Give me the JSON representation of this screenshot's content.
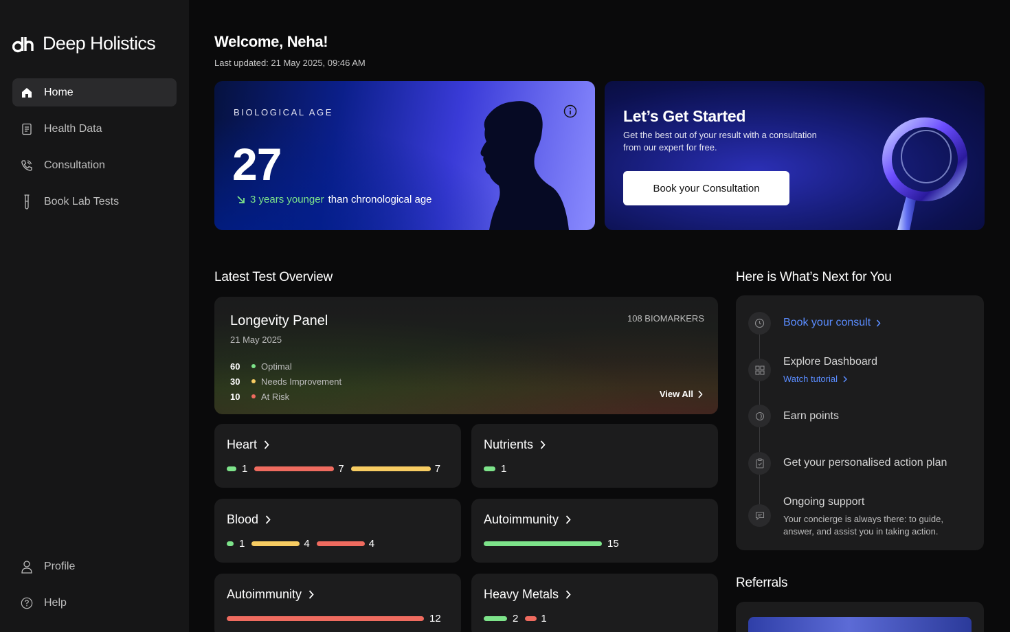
{
  "brand": {
    "name": "Deep Holistics"
  },
  "sidebar": {
    "items": [
      {
        "label": "Home",
        "icon": "home-icon",
        "active": true
      },
      {
        "label": "Health Data",
        "icon": "document-icon",
        "active": false
      },
      {
        "label": "Consultation",
        "icon": "phone-icon",
        "active": false
      },
      {
        "label": "Book Lab Tests",
        "icon": "test-tube-icon",
        "active": false
      }
    ],
    "bottom": [
      {
        "label": "Profile",
        "icon": "user-icon"
      },
      {
        "label": "Help",
        "icon": "help-icon"
      }
    ]
  },
  "header": {
    "welcome": "Welcome, Neha!",
    "updated": "Last updated: 21 May 2025, 09:46 AM"
  },
  "bio_age": {
    "label": "BIOLOGICAL AGE",
    "value": "27",
    "delta": "3 years younger",
    "delta_suffix": "than chronological age"
  },
  "consult": {
    "title": "Let’s Get Started",
    "description": "Get the best out of your result with a consultation from our expert for free.",
    "button": "Book your Consultation"
  },
  "overview": {
    "title": "Latest Test Overview",
    "panel": {
      "title": "Longevity Panel",
      "date": "21 May 2025",
      "count": "108 BIOMARKERS",
      "stats": [
        {
          "num": "60",
          "label": "Optimal",
          "color": "#7de38a"
        },
        {
          "num": "30",
          "label": "Needs Improvement",
          "color": "#f7cc62"
        },
        {
          "num": "10",
          "label": "At Risk",
          "color": "#ef6b5f"
        }
      ],
      "view_all": "View All"
    },
    "categories": [
      {
        "title": "Heart",
        "bars": [
          {
            "kind": "green",
            "value": "1"
          },
          {
            "kind": "red",
            "value": "7"
          },
          {
            "kind": "yellow",
            "value": "7"
          }
        ]
      },
      {
        "title": "Nutrients",
        "bars": [
          {
            "kind": "green",
            "value": "1"
          }
        ]
      },
      {
        "title": "Blood",
        "bars": [
          {
            "kind": "green",
            "value": "1"
          },
          {
            "kind": "yellow",
            "value": "4"
          },
          {
            "kind": "red",
            "value": "4"
          }
        ]
      },
      {
        "title": "Autoimmunity",
        "bars": [
          {
            "kind": "green",
            "value": "15"
          }
        ]
      },
      {
        "title": "Autoimmunity",
        "bars": [
          {
            "kind": "red",
            "value": "12"
          }
        ]
      },
      {
        "title": "Heavy Metals",
        "bars": [
          {
            "kind": "green",
            "value": "2"
          },
          {
            "kind": "red",
            "value": "1"
          }
        ]
      }
    ]
  },
  "next": {
    "title": "Here is What’s Next for You",
    "steps": {
      "book": "Book your consult",
      "explore": "Explore Dashboard",
      "watch": "Watch tutorial",
      "earn": "Earn points",
      "plan": "Get your personalised action plan",
      "support": "Ongoing support",
      "support_desc": "Your concierge is always there: to guide, answer, and assist you in taking action."
    }
  },
  "referrals": {
    "title": "Referrals"
  }
}
